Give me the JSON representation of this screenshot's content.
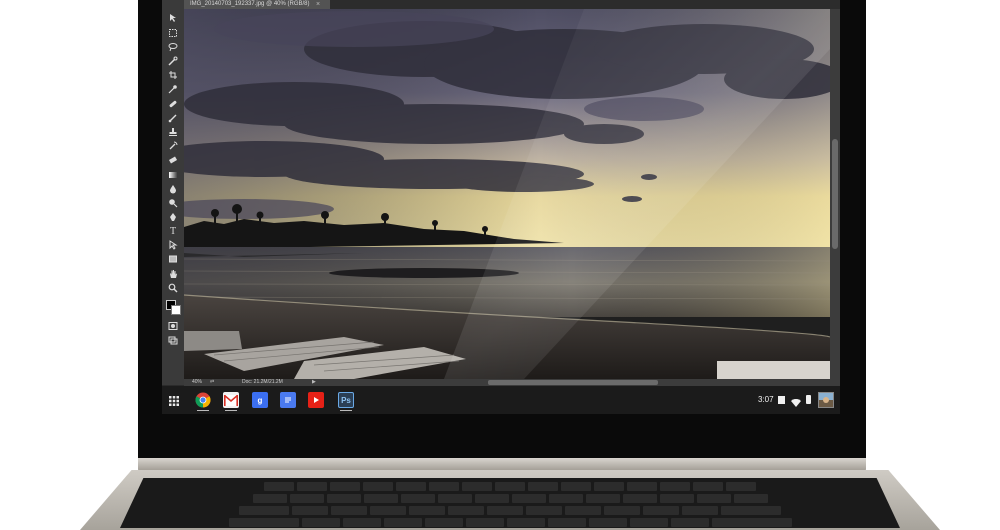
{
  "document": {
    "tab_title": "IMG_20140703_192337.jpg @ 40% (RGB/8)",
    "close_glyph": "×"
  },
  "status": {
    "zoom": "40%",
    "doc_size": "Doc: 21.2M/21.2M"
  },
  "toolbox": {
    "text_tool_glyph": "T",
    "tools": [
      "move-tool",
      "marquee-tool",
      "lasso-tool",
      "quick-selection-tool",
      "crop-tool",
      "eyedropper-tool",
      "spot-healing-tool",
      "brush-tool",
      "clone-stamp-tool",
      "history-brush-tool",
      "eraser-tool",
      "gradient-tool",
      "blur-tool",
      "dodge-tool",
      "pen-tool",
      "type-tool",
      "path-selection-tool",
      "rectangle-tool",
      "hand-tool",
      "zoom-tool"
    ]
  },
  "shelf": {
    "apps": [
      {
        "name": "Chrome",
        "icon": "chrome-icon",
        "color": "#4285F4"
      },
      {
        "name": "Gmail",
        "icon": "gmail-icon",
        "color": "#d93025"
      },
      {
        "name": "Google Search",
        "icon": "google-search-icon",
        "color": "#3b6ff2",
        "glyph": "g"
      },
      {
        "name": "Docs",
        "icon": "docs-icon",
        "color": "#4a7af0"
      },
      {
        "name": "YouTube",
        "icon": "youtube-icon",
        "color": "#e62117"
      },
      {
        "name": "Photoshop",
        "icon": "photoshop-icon",
        "color": "#2b3f55",
        "glyph": "Ps"
      }
    ],
    "time": "3:07"
  },
  "colors": {
    "sky_top": "#5c5a6e",
    "sky_horizon": "#e8d79a",
    "water": "#6e6c6a",
    "sand": "#3a3532",
    "ps_panel": "#3a3a3a",
    "shelf": "#1b1b1b"
  }
}
